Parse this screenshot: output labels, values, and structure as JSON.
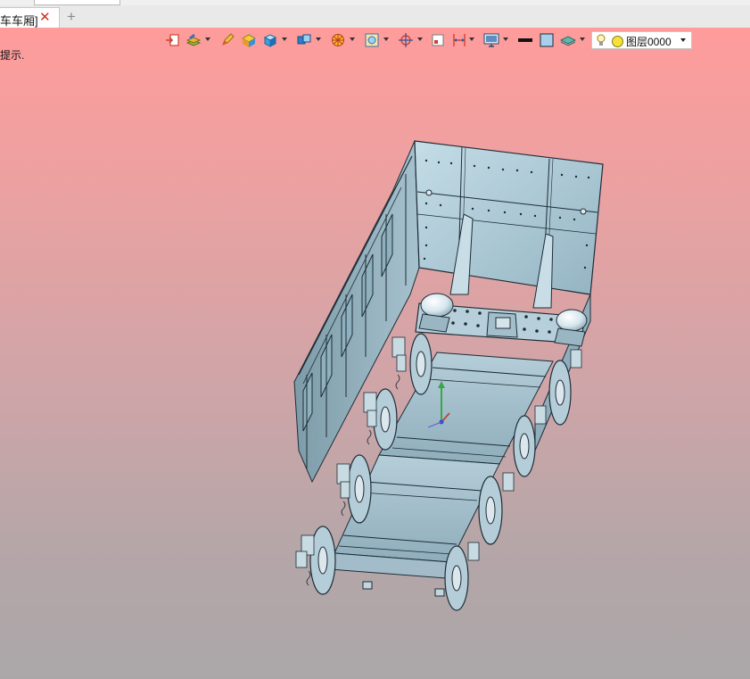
{
  "tabs": {
    "active_label": "车车厢]",
    "close_glyph": "✕",
    "add_glyph": "+"
  },
  "viewport": {
    "hint_text": "提示.",
    "background_top": "#ff9c9c",
    "background_bottom": "#aba7a9"
  },
  "toolbar": {
    "icons": [
      "sketch-import-icon",
      "layers-stack-icon",
      "pencil-icon",
      "display-style-icon",
      "cube-icon",
      "view-cubes-icon",
      "render-sphere-icon",
      "zoom-window-icon",
      "target-icon",
      "section-box-icon",
      "dimension-icon",
      "monitor-icon",
      "line-color-icon",
      "fill-color-icon",
      "layer-manager-icon"
    ],
    "layer": {
      "name": "图层0000",
      "state_color": "#f2e23a"
    }
  },
  "model": {
    "name": "mine-car-body",
    "body_color": "#a9c4cf"
  }
}
